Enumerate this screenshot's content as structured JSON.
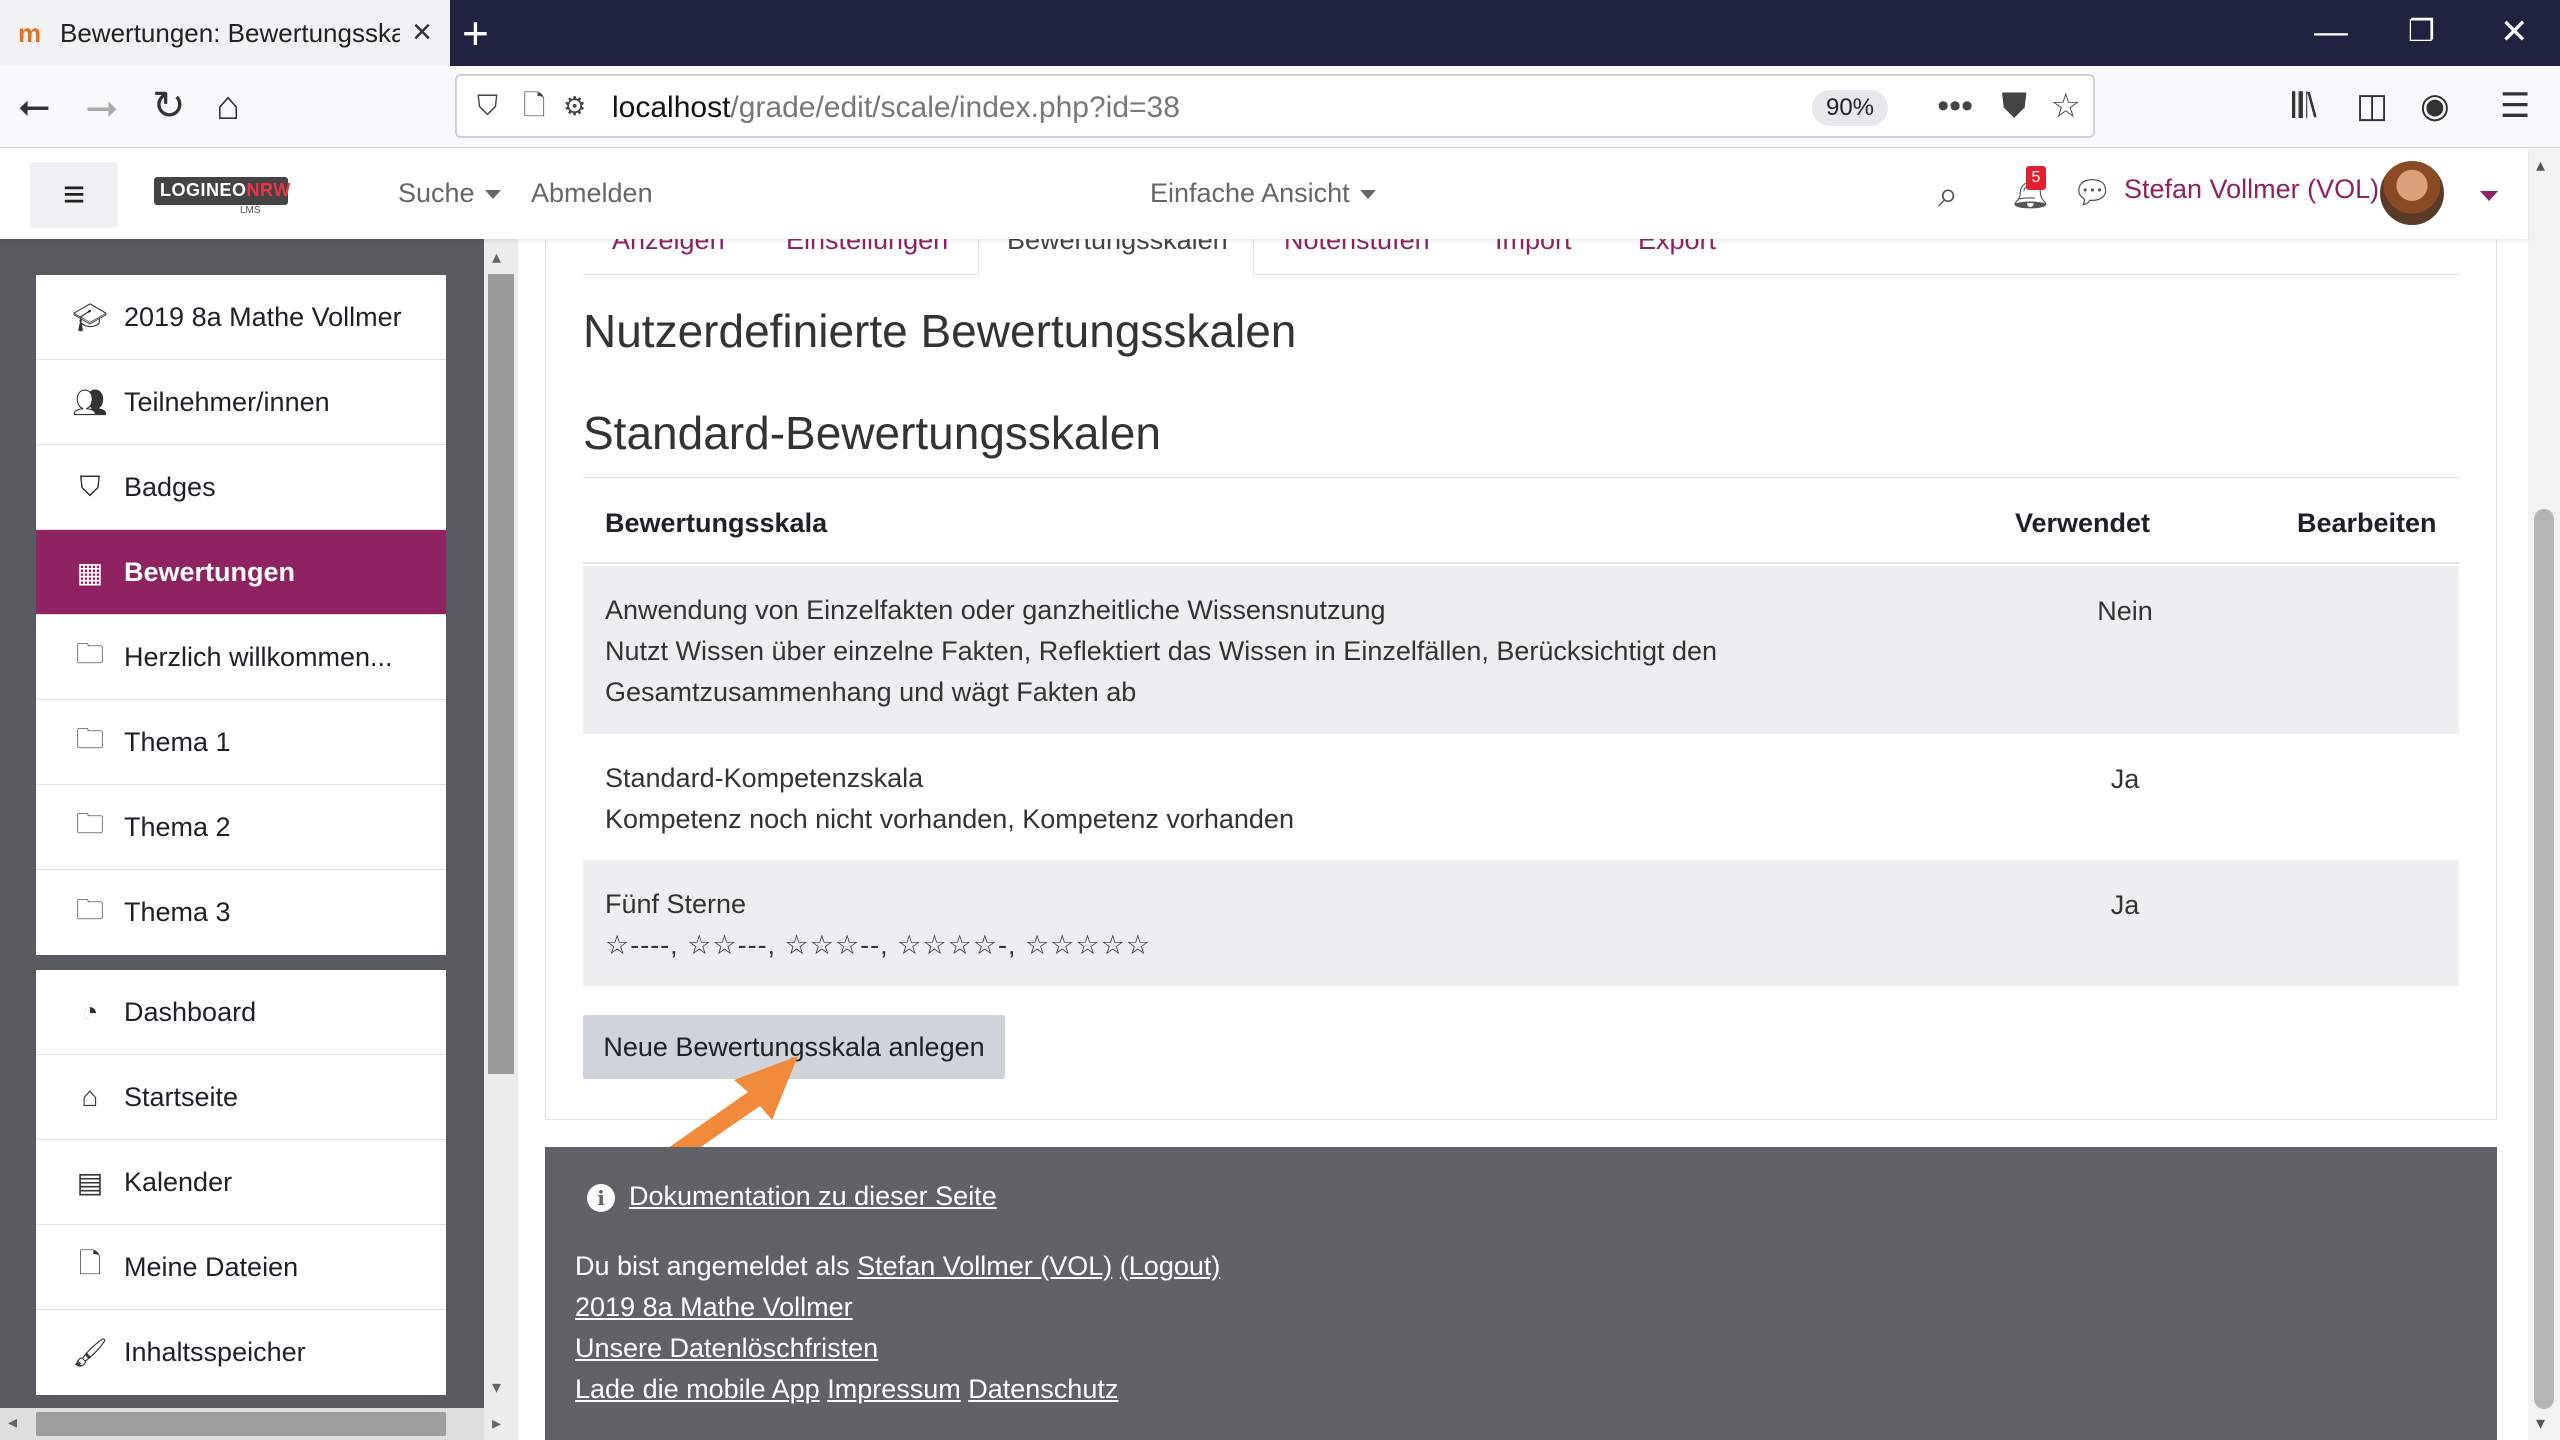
{
  "browser": {
    "tab_title": "Bewertungen: Bewertungsskalen",
    "url_host": "localhost",
    "url_path": "/grade/edit/scale/index.php?id=38",
    "zoom": "90%"
  },
  "header": {
    "search_label": "Suche",
    "logout_label": "Abmelden",
    "view_label": "Einfache Ansicht",
    "notification_count": "5",
    "user_name": "Stefan Vollmer (VOL)",
    "logo_text_1": "LOGINEO",
    "logo_text_2": "NRW",
    "logo_sub": "LMS"
  },
  "drawer": {
    "course_items": [
      {
        "label": "2019 8a Mathe Vollmer",
        "icon": "graduation-cap-icon"
      },
      {
        "label": "Teilnehmer/innen",
        "icon": "users-icon"
      },
      {
        "label": "Badges",
        "icon": "shield-icon"
      },
      {
        "label": "Bewertungen",
        "icon": "table-icon",
        "active": true
      },
      {
        "label": "Herzlich willkommen...",
        "icon": "folder-icon"
      },
      {
        "label": "Thema 1",
        "icon": "folder-icon"
      },
      {
        "label": "Thema 2",
        "icon": "folder-icon"
      },
      {
        "label": "Thema 3",
        "icon": "folder-icon"
      }
    ],
    "site_items": [
      {
        "label": "Dashboard",
        "icon": "dashboard-icon"
      },
      {
        "label": "Startseite",
        "icon": "home-icon"
      },
      {
        "label": "Kalender",
        "icon": "calendar-icon"
      },
      {
        "label": "Meine Dateien",
        "icon": "file-icon"
      },
      {
        "label": "Inhaltsspeicher",
        "icon": "brush-icon"
      }
    ]
  },
  "tabs": [
    "Anzeigen",
    "Einstellungen",
    "Bewertungsskalen",
    "Notenstufen",
    "Import",
    "Export"
  ],
  "active_tab": "Bewertungsskalen",
  "main": {
    "title": "Nutzerdefinierte Bewertungsskalen",
    "subtitle": "Standard-Bewertungsskalen",
    "table": {
      "headers": [
        "Bewertungsskala",
        "Verwendet",
        "Bearbeiten"
      ],
      "rows": [
        {
          "name": "Anwendung von Einzelfakten oder ganzheitliche Wissensnutzung",
          "items_line1": "Nutzt Wissen über einzelne Fakten, Reflektiert das Wissen in Einzelfällen, Berücksichtigt den",
          "items_line2": "Gesamtzusammenhang und wägt Fakten ab",
          "used": "Nein"
        },
        {
          "name": "Standard-Kompetenzskala",
          "items_line1": "Kompetenz noch nicht vorhanden, Kompetenz vorhanden",
          "used": "Ja"
        },
        {
          "name": "Fünf Sterne",
          "items_line1": "☆----, ☆☆---, ☆☆☆--, ☆☆☆☆-, ☆☆☆☆☆",
          "used": "Ja"
        }
      ]
    },
    "new_button": "Neue Bewertungsskala anlegen"
  },
  "footer": {
    "doc_link": "Dokumentation zu dieser Seite",
    "logged_in_prefix": "Du bist angemeldet als",
    "user_link": "Stefan Vollmer (VOL)",
    "logout_link": "(Logout)",
    "course_link": "2019 8a Mathe Vollmer",
    "deletion_link": "Unsere Datenlöschfristen",
    "app_link": "Lade die mobile App",
    "imprint_link": "Impressum",
    "privacy_link": "Datenschutz"
  },
  "colors": {
    "brand": "#8f2261",
    "footer_bg": "#5f6368",
    "drawer_bg": "#575b60",
    "highlight_arrow": "#f28a3c"
  }
}
